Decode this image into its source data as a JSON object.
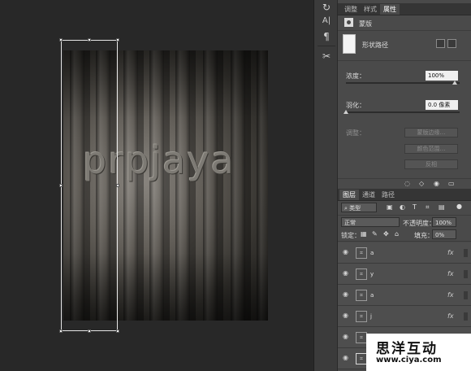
{
  "artwork": {
    "word": "prpjaya"
  },
  "tools": [
    {
      "icon": "history-icon",
      "glyph": "↻"
    },
    {
      "icon": "character-icon",
      "glyph": "A|"
    },
    {
      "icon": "paragraph-icon",
      "glyph": "¶"
    },
    {
      "icon": "tool-presets-icon",
      "glyph": "✂"
    }
  ],
  "properties_panel": {
    "tabs": [
      "调整",
      "样式",
      "属性"
    ],
    "active_tab": "属性",
    "header_label": "蒙版",
    "mask_type": "形状路径",
    "density_label": "浓度：",
    "density_value": "100%",
    "feather_label": "羽化：",
    "feather_value": "0.0 像素",
    "refine_label": "调整：",
    "buttons": [
      "蒙版边缘…",
      "颜色范围…",
      "反相"
    ]
  },
  "layers_panel": {
    "tabs": [
      "图层",
      "通道",
      "路径"
    ],
    "active_tab": "图层",
    "filter_kind": "类型",
    "filter_icons": [
      "image-filter-icon",
      "adjustment-filter-icon",
      "type-filter-icon",
      "shape-filter-icon",
      "smart-object-filter-icon"
    ],
    "blend_mode": "正常",
    "opacity_label": "不透明度：",
    "opacity_value": "100%",
    "lock_label": "锁定：",
    "fill_label": "填充：",
    "fill_value": "0%",
    "layers": [
      {
        "name": "a",
        "fx": "fx"
      },
      {
        "name": "y",
        "fx": "fx"
      },
      {
        "name": "a",
        "fx": "fx"
      },
      {
        "name": "j",
        "fx": "fx"
      },
      {
        "name": "",
        "fx": ""
      },
      {
        "name": "",
        "fx": ""
      }
    ]
  },
  "watermark": {
    "title": "思洋互动",
    "url": "www.ciya.com"
  }
}
